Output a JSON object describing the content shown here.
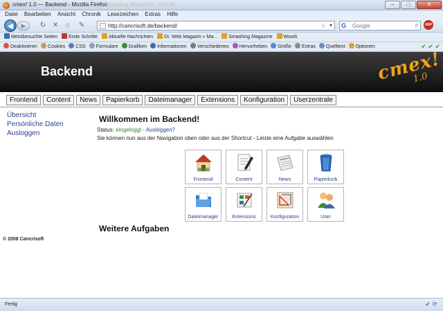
{
  "window": {
    "title": "cmex! 1.0 — Backend - Mozilla Firefox",
    "ghost_tab": "Smashing Magazine · Woork",
    "minimize": "–",
    "maximize": "□",
    "close": "✕"
  },
  "menu": [
    "Datei",
    "Bearbeiten",
    "Ansicht",
    "Chronik",
    "Lesezeichen",
    "Extras",
    "Hilfe"
  ],
  "nav": {
    "url": "http://cancrisoft.de/backend/",
    "search_placeholder": "Google",
    "search_engine_letter": "G",
    "adblock_label": "ABP"
  },
  "bookmarks": [
    {
      "label": "Meistbesuchte Seiten",
      "color": "#3b6db0"
    },
    {
      "label": "Erste Schritte",
      "color": "#c0392b"
    },
    {
      "label": "Aktuelle Nachrichten",
      "color": "#e0a020"
    },
    {
      "label": "Dr. Web Magazin » Ma...",
      "color": "#e0a020"
    },
    {
      "label": "Smashing Magazine",
      "color": "#e0a020"
    },
    {
      "label": "Woork",
      "color": "#e0a020"
    }
  ],
  "devtools": [
    {
      "label": "Deaktivieren",
      "color": "#d9534f"
    },
    {
      "label": "Cookies",
      "color": "#c89b5a"
    },
    {
      "label": "CSS",
      "color": "#5a7fb8"
    },
    {
      "label": "Formulare",
      "color": "#8aa0bf"
    },
    {
      "label": "Grafiken",
      "color": "#3d8b3d"
    },
    {
      "label": "Informationen",
      "color": "#3b6db0"
    },
    {
      "label": "Verschiedenes",
      "color": "#7a7a7a"
    },
    {
      "label": "Hervorheben",
      "color": "#a35db5"
    },
    {
      "label": "Größe",
      "color": "#4d8bd6"
    },
    {
      "label": "Extras",
      "color": "#8a8a8a"
    },
    {
      "label": "Quelltext",
      "color": "#6f8db8"
    },
    {
      "label": "Optionen",
      "color": "#d6a22e"
    }
  ],
  "page": {
    "banner_title": "Backend",
    "logo": "cmex!",
    "logo_version": "1.0",
    "tabs": [
      "Frontend",
      "Content",
      "News",
      "Papierkorb",
      "Dateimanager",
      "Extensions",
      "Konfiguration",
      "Userzentrale"
    ],
    "sidenav": [
      "Übersicht",
      "Persönliche Daten",
      "Ausloggen"
    ],
    "heading": "Willkommen im Backend!",
    "status_label": "Status:",
    "status_value": "eingeloggt",
    "status_sep": "-",
    "logout_link": "Ausloggen?",
    "description": "Sie können nun aus der Navigation oben oder aus der Shortcut - Leiste eine Aufgabe auswählen",
    "tiles": [
      {
        "label": "Frontend",
        "icon": "house-icon"
      },
      {
        "label": "Content",
        "icon": "document-pen-icon"
      },
      {
        "label": "News",
        "icon": "newspaper-icon"
      },
      {
        "label": "Papierkorb",
        "icon": "trash-bin-icon"
      },
      {
        "label": "Dateimanager",
        "icon": "folder-icon"
      },
      {
        "label": "Extensions",
        "icon": "paint-palette-icon"
      },
      {
        "label": "Konfiguration",
        "icon": "drafting-tools-icon"
      },
      {
        "label": "User",
        "icon": "users-icon"
      }
    ],
    "subheading": "Weitere Aufgaben",
    "copyright": "© 2008 Cancrisoft"
  },
  "statusbar": {
    "text": "Fertig"
  }
}
